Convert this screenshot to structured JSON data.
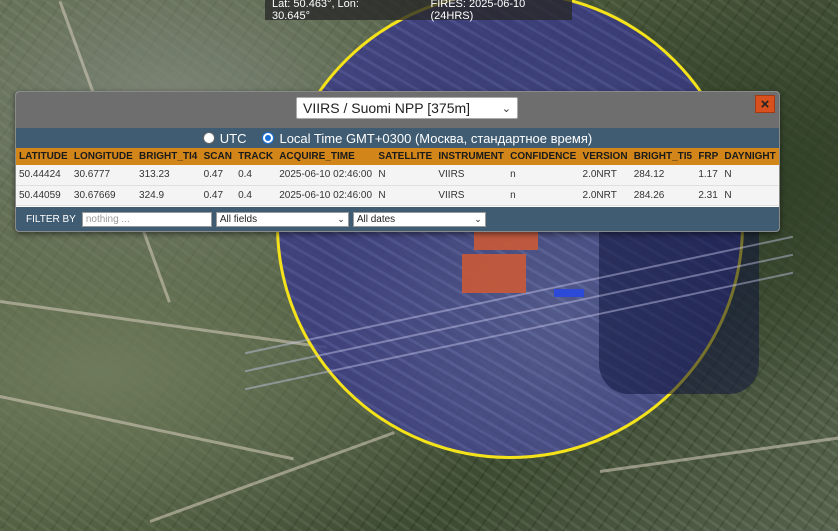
{
  "status_bar": {
    "coords": "Lat: 50.463°, Lon: 30.645°",
    "fires": "FIRES: 2025-06-10 (24HRS)"
  },
  "panel": {
    "sensor_select": "VIIRS / Suomi NPP [375m]",
    "close_label": "×",
    "time_options": {
      "utc_label": "UTC",
      "local_label": "Local Time GMT+0300 (Москва, стандартное время)",
      "selected": "local"
    },
    "table": {
      "columns": [
        "LATITUDE",
        "LONGITUDE",
        "BRIGHT_TI4",
        "SCAN",
        "TRACK",
        "ACQUIRE_TIME",
        "SATELLITE",
        "INSTRUMENT",
        "CONFIDENCE",
        "VERSION",
        "BRIGHT_TI5",
        "FRP",
        "DAYNIGHT"
      ],
      "rows": [
        [
          "50.44424",
          "30.6777",
          "313.23",
          "0.47",
          "0.4",
          "2025-06-10 02:46:00",
          "N",
          "VIIRS",
          "n",
          "2.0NRT",
          "284.12",
          "1.17",
          "N"
        ],
        [
          "50.44059",
          "30.67669",
          "324.9",
          "0.47",
          "0.4",
          "2025-06-10 02:46:00",
          "N",
          "VIIRS",
          "n",
          "2.0NRT",
          "284.26",
          "2.31",
          "N"
        ]
      ]
    },
    "filter": {
      "label": "FILTER BY",
      "placeholder": "nothing ...",
      "fields_select": "All fields",
      "dates_select": "All dates"
    }
  },
  "colors": {
    "circle_outline": "#f4e21a",
    "fire_pixel": "#c4583a",
    "header_orange": "#d2861a",
    "bar_blue": "#3f5c73"
  }
}
